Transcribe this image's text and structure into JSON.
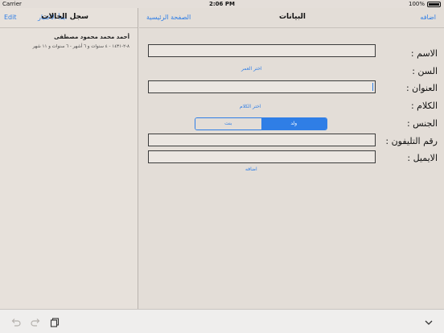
{
  "status_bar": {
    "carrier": "Carrier",
    "time": "2:06 PM",
    "battery": "100%",
    "battery_level": 1.0
  },
  "left_nav": {
    "edit": "Edit",
    "start_test": "ابدأ الاختبار",
    "title": "سجل الحالات"
  },
  "record": {
    "name": "أحمد محمد محمود مصطفى",
    "details": "٨-٢-١٤٣١ - ٤ سنوات و ٦ أشهر - ٦ سنوات و ١١ شهر"
  },
  "right_nav": {
    "home": "الصفحة الرئيسية",
    "title": "البيانات",
    "add": "اضافه"
  },
  "form": {
    "name_label": "الاسم :",
    "age_label": "السن :",
    "choose_age": "اختر العمر",
    "address_label": "العنوان :",
    "speech_label": "الكلام :",
    "choose_speech": "اختر الكلام",
    "gender_label": "الجنس :",
    "gender_female": "بنت",
    "gender_male": "ولد",
    "phone_label": "رقم التليفون :",
    "email_label": "الايميل :",
    "add_button": "اضافه",
    "name_value": "",
    "address_value": "",
    "phone_value": "",
    "email_value": ""
  },
  "toolbar": {
    "icons": [
      "undo-icon",
      "redo-icon",
      "paste-icon",
      "chevron-down-icon"
    ]
  },
  "colors": {
    "accent": "#2f7ee6",
    "background": "#e4ded9"
  }
}
